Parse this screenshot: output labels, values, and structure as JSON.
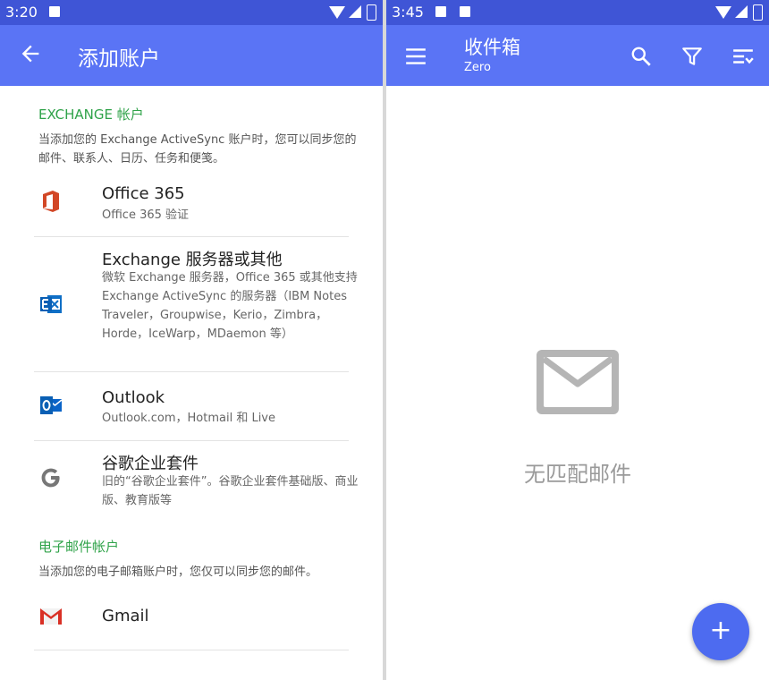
{
  "left": {
    "status_time": "3:20",
    "title": "添加账户",
    "exchange_header": "EXCHANGE 帐户",
    "exchange_desc": "当添加您的 Exchange ActiveSync 账户时，您可以同步您的邮件、联系人、日历、任务和便笺。",
    "items": [
      {
        "title": "Office 365",
        "subtitle": "Office 365 验证",
        "icon": "office365-icon"
      },
      {
        "title": "Exchange 服务器或其他",
        "subtitle": "微软 Exchange 服务器，Office 365 或其他支持 Exchange ActiveSync 的服务器（IBM Notes Traveler，Groupwise，Kerio，Zimbra，Horde，IceWarp，MDaemon 等）",
        "icon": "exchange-icon"
      },
      {
        "title": "Outlook",
        "subtitle": "Outlook.com，Hotmail 和 Live",
        "icon": "outlook-icon"
      },
      {
        "title": "谷歌企业套件",
        "subtitle": "旧的“谷歌企业套件”。谷歌企业套件基础版、商业版、教育版等",
        "icon": "google-icon"
      }
    ],
    "email_header": "电子邮件帐户",
    "email_desc": "当添加您的电子邮箱账户时，您仅可以同步您的邮件。",
    "gmail": {
      "title": "Gmail",
      "icon": "gmail-icon"
    }
  },
  "right": {
    "status_time": "3:45",
    "title": "收件箱",
    "subtitle": "Zero",
    "empty_text": "无匹配邮件",
    "fab_label": "+"
  },
  "colors": {
    "statusbar": "#3f55d6",
    "appbar": "#5a74f5",
    "accent_green": "#30a34a",
    "office_red": "#d24726",
    "exchange_blue": "#0f6fc6",
    "outlook_blue": "#0a64c8",
    "gmail_red": "#d93025",
    "fab": "#4d6bf0"
  }
}
